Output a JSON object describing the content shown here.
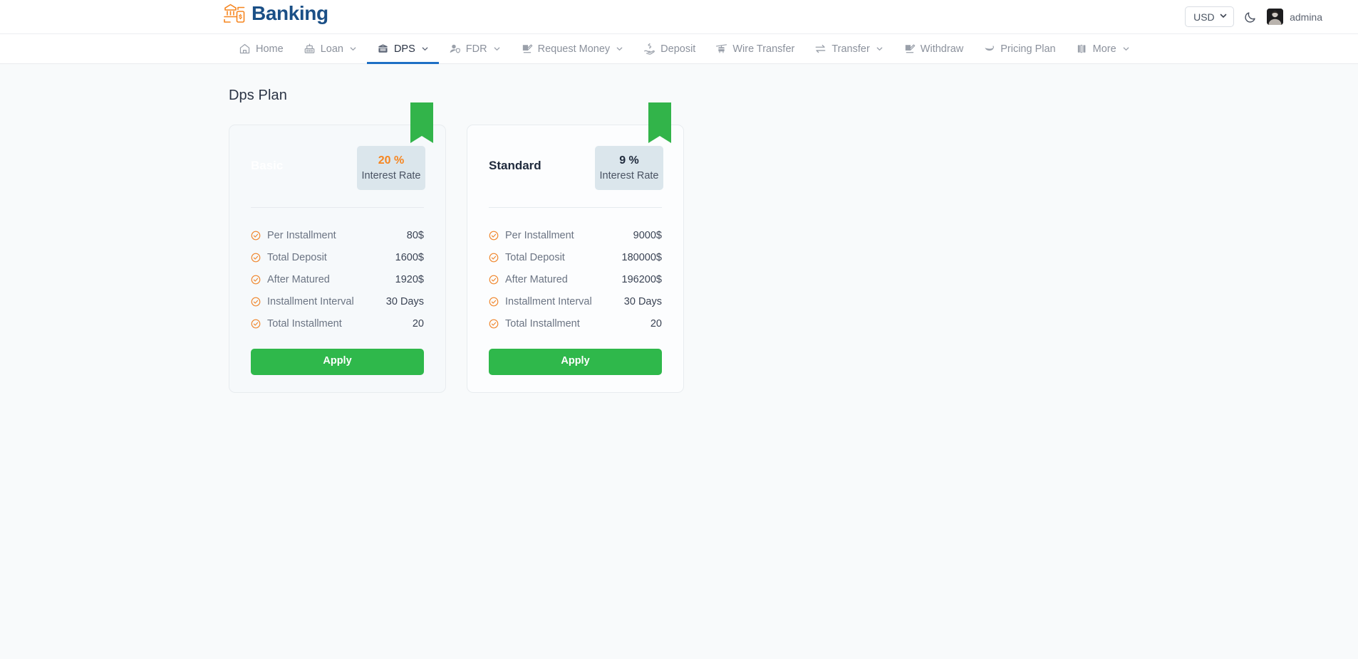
{
  "header": {
    "brand": "Banking",
    "brand_icon": "bank-mobile-logo-icon",
    "currency": {
      "selected": "USD",
      "options": [
        "USD"
      ]
    },
    "theme_toggle_icon": "moon-icon",
    "avatar_icon": "user-avatar",
    "username": "admina"
  },
  "nav": {
    "items": [
      {
        "label": "Home",
        "icon": "home-icon",
        "caret": false,
        "active": false
      },
      {
        "label": "Loan",
        "icon": "cash-register-icon",
        "caret": true,
        "active": false
      },
      {
        "label": "DPS",
        "icon": "bank-vault-icon",
        "caret": true,
        "active": true
      },
      {
        "label": "FDR",
        "icon": "user-shield-icon",
        "caret": true,
        "active": false
      },
      {
        "label": "Request Money",
        "icon": "request-money-icon",
        "caret": true,
        "active": false
      },
      {
        "label": "Deposit",
        "icon": "hand-money-icon",
        "caret": false,
        "active": false
      },
      {
        "label": "Wire Transfer",
        "icon": "wire-tower-icon",
        "caret": false,
        "active": false
      },
      {
        "label": "Transfer",
        "icon": "exchange-arrows-icon",
        "caret": true,
        "active": false
      },
      {
        "label": "Withdraw",
        "icon": "withdraw-doc-icon",
        "caret": false,
        "active": false
      },
      {
        "label": "Pricing Plan",
        "icon": "swoosh-icon",
        "caret": false,
        "active": false
      },
      {
        "label": "More",
        "icon": "book-stack-icon",
        "caret": true,
        "active": false
      }
    ]
  },
  "main": {
    "title": "Dps Plan",
    "plans": [
      {
        "name": "Basic",
        "rate_value": "20 %",
        "rate_label": "Interest Rate",
        "ribbon_icon": "bookmark-ribbon-icon",
        "features": [
          {
            "label": "Per Installment",
            "value": "80$",
            "icon": "check-circle-icon"
          },
          {
            "label": "Total Deposit",
            "value": "1600$",
            "icon": "check-circle-icon"
          },
          {
            "label": "After Matured",
            "value": "1920$",
            "icon": "check-circle-icon"
          },
          {
            "label": "Installment Interval",
            "value": "30 Days",
            "icon": "check-circle-icon"
          },
          {
            "label": "Total Installment",
            "value": "20",
            "icon": "check-circle-icon"
          }
        ],
        "apply_label": "Apply"
      },
      {
        "name": "Standard",
        "rate_value": "9 %",
        "rate_label": "Interest Rate",
        "ribbon_icon": "bookmark-ribbon-icon",
        "features": [
          {
            "label": "Per Installment",
            "value": "9000$",
            "icon": "check-circle-icon"
          },
          {
            "label": "Total Deposit",
            "value": "180000$",
            "icon": "check-circle-icon"
          },
          {
            "label": "After Matured",
            "value": "196200$",
            "icon": "check-circle-icon"
          },
          {
            "label": "Installment Interval",
            "value": "30 Days",
            "icon": "check-circle-icon"
          },
          {
            "label": "Total Installment",
            "value": "20",
            "icon": "check-circle-icon"
          }
        ],
        "apply_label": "Apply"
      }
    ]
  },
  "colors": {
    "brand_blue": "#1a4f86",
    "accent_orange": "#f6851f",
    "apply_green": "#2fb84b",
    "active_tab_blue": "#1e6fc4",
    "badge_bg": "#dbe6ec",
    "page_bg": "#f8fafb"
  }
}
